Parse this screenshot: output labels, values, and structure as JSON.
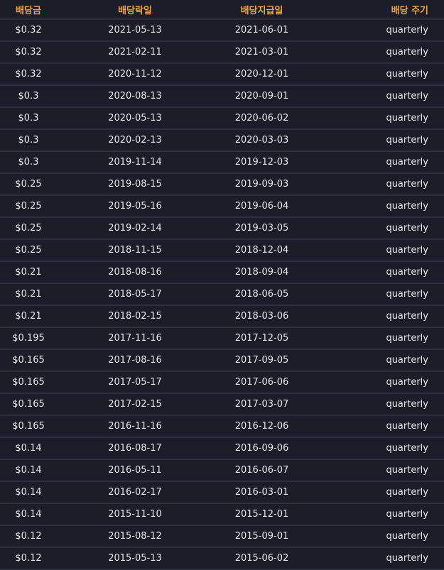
{
  "headers": {
    "amount": "배당금",
    "ex_date": "배당락일",
    "pay_date": "배당지급일",
    "frequency": "배당 주기"
  },
  "rows": [
    {
      "amount": "$0.32",
      "ex_date": "2021-05-13",
      "pay_date": "2021-06-01",
      "frequency": "quarterly"
    },
    {
      "amount": "$0.32",
      "ex_date": "2021-02-11",
      "pay_date": "2021-03-01",
      "frequency": "quarterly"
    },
    {
      "amount": "$0.32",
      "ex_date": "2020-11-12",
      "pay_date": "2020-12-01",
      "frequency": "quarterly"
    },
    {
      "amount": "$0.3",
      "ex_date": "2020-08-13",
      "pay_date": "2020-09-01",
      "frequency": "quarterly"
    },
    {
      "amount": "$0.3",
      "ex_date": "2020-05-13",
      "pay_date": "2020-06-02",
      "frequency": "quarterly"
    },
    {
      "amount": "$0.3",
      "ex_date": "2020-02-13",
      "pay_date": "2020-03-03",
      "frequency": "quarterly"
    },
    {
      "amount": "$0.3",
      "ex_date": "2019-11-14",
      "pay_date": "2019-12-03",
      "frequency": "quarterly"
    },
    {
      "amount": "$0.25",
      "ex_date": "2019-08-15",
      "pay_date": "2019-09-03",
      "frequency": "quarterly"
    },
    {
      "amount": "$0.25",
      "ex_date": "2019-05-16",
      "pay_date": "2019-06-04",
      "frequency": "quarterly"
    },
    {
      "amount": "$0.25",
      "ex_date": "2019-02-14",
      "pay_date": "2019-03-05",
      "frequency": "quarterly"
    },
    {
      "amount": "$0.25",
      "ex_date": "2018-11-15",
      "pay_date": "2018-12-04",
      "frequency": "quarterly"
    },
    {
      "amount": "$0.21",
      "ex_date": "2018-08-16",
      "pay_date": "2018-09-04",
      "frequency": "quarterly"
    },
    {
      "amount": "$0.21",
      "ex_date": "2018-05-17",
      "pay_date": "2018-06-05",
      "frequency": "quarterly"
    },
    {
      "amount": "$0.21",
      "ex_date": "2018-02-15",
      "pay_date": "2018-03-06",
      "frequency": "quarterly"
    },
    {
      "amount": "$0.195",
      "ex_date": "2017-11-16",
      "pay_date": "2017-12-05",
      "frequency": "quarterly"
    },
    {
      "amount": "$0.165",
      "ex_date": "2017-08-16",
      "pay_date": "2017-09-05",
      "frequency": "quarterly"
    },
    {
      "amount": "$0.165",
      "ex_date": "2017-05-17",
      "pay_date": "2017-06-06",
      "frequency": "quarterly"
    },
    {
      "amount": "$0.165",
      "ex_date": "2017-02-15",
      "pay_date": "2017-03-07",
      "frequency": "quarterly"
    },
    {
      "amount": "$0.165",
      "ex_date": "2016-11-16",
      "pay_date": "2016-12-06",
      "frequency": "quarterly"
    },
    {
      "amount": "$0.14",
      "ex_date": "2016-08-17",
      "pay_date": "2016-09-06",
      "frequency": "quarterly"
    },
    {
      "amount": "$0.14",
      "ex_date": "2016-05-11",
      "pay_date": "2016-06-07",
      "frequency": "quarterly"
    },
    {
      "amount": "$0.14",
      "ex_date": "2016-02-17",
      "pay_date": "2016-03-01",
      "frequency": "quarterly"
    },
    {
      "amount": "$0.14",
      "ex_date": "2015-11-10",
      "pay_date": "2015-12-01",
      "frequency": "quarterly"
    },
    {
      "amount": "$0.12",
      "ex_date": "2015-08-12",
      "pay_date": "2015-09-01",
      "frequency": "quarterly"
    },
    {
      "amount": "$0.12",
      "ex_date": "2015-05-13",
      "pay_date": "2015-06-02",
      "frequency": "quarterly"
    }
  ]
}
